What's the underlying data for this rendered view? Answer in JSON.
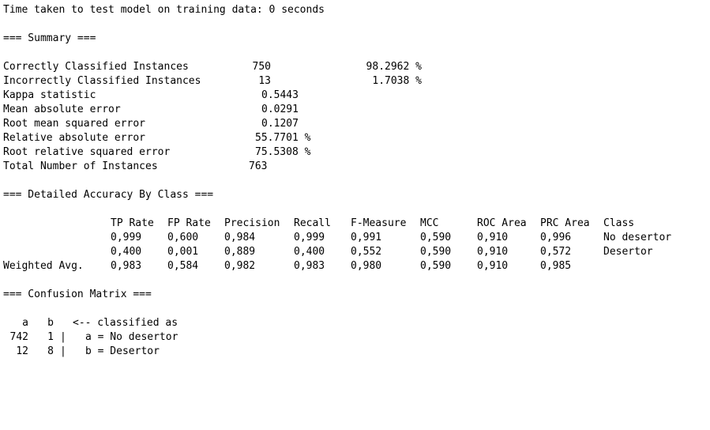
{
  "header": {
    "time_line": "Time taken to test model on training data: 0 seconds"
  },
  "summary": {
    "heading": "=== Summary ===",
    "rows": [
      {
        "label": "Correctly Classified Instances",
        "value": "750",
        "percent": "98.2962 %"
      },
      {
        "label": "Incorrectly Classified Instances",
        "value": "13",
        "percent": "1.7038 %"
      },
      {
        "label": "Kappa statistic",
        "value": "0.5443"
      },
      {
        "label": "Mean absolute error",
        "value": "0.0291"
      },
      {
        "label": "Root mean squared error",
        "value": "0.1207"
      },
      {
        "label": "Relative absolute error",
        "value": "55.7701 %"
      },
      {
        "label": "Root relative squared error",
        "value": "75.5308 %"
      },
      {
        "label": "Total Number of Instances",
        "value": "763"
      }
    ]
  },
  "accuracy": {
    "heading": "=== Detailed Accuracy By Class ===",
    "columns": [
      "TP Rate",
      "FP Rate",
      "Precision",
      "Recall",
      "F-Measure",
      "MCC",
      "ROC Area",
      "PRC Area",
      "Class"
    ],
    "rows": [
      {
        "label": "",
        "cells": [
          "0,999",
          "0,600",
          "0,984",
          "0,999",
          "0,991",
          "0,590",
          "0,910",
          "0,996",
          "No desertor"
        ]
      },
      {
        "label": "",
        "cells": [
          "0,400",
          "0,001",
          "0,889",
          "0,400",
          "0,552",
          "0,590",
          "0,910",
          "0,572",
          "Desertor"
        ]
      },
      {
        "label": "Weighted Avg.",
        "cells": [
          "0,983",
          "0,584",
          "0,982",
          "0,983",
          "0,980",
          "0,590",
          "0,910",
          "0,985",
          ""
        ]
      }
    ]
  },
  "confusion": {
    "heading": "=== Confusion Matrix ===",
    "header": {
      "a": "a",
      "b": "b",
      "note": "<-- classified as"
    },
    "rows": [
      {
        "a": "742",
        "b": "1",
        "sep": "|",
        "label": "a = No desertor"
      },
      {
        "a": "12",
        "b": "8",
        "sep": "|",
        "label": "b = Desertor"
      }
    ]
  }
}
